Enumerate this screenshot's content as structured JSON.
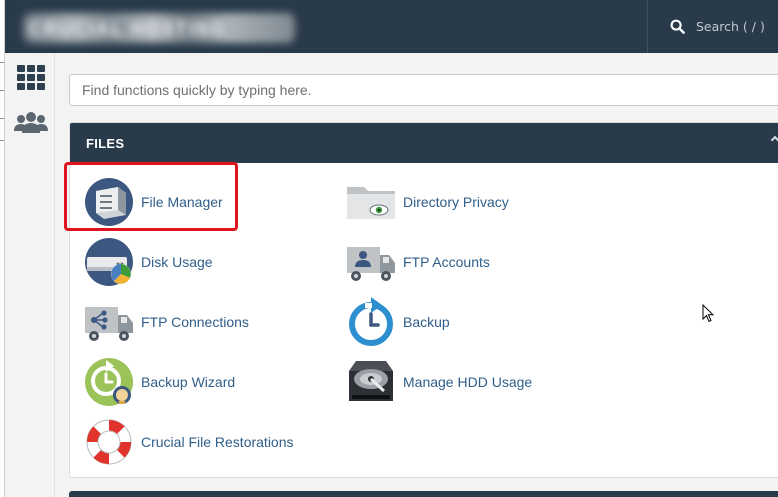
{
  "header": {
    "logo_text": "CRUCIAL HOSTING",
    "search_label": "Search ( / )"
  },
  "sidebar": {
    "items": [
      {
        "icon": "grid-icon"
      },
      {
        "icon": "users-icon"
      }
    ]
  },
  "search": {
    "placeholder": "Find functions quickly by typing here."
  },
  "files_panel": {
    "title": "FILES",
    "items": [
      {
        "label": "File Manager",
        "icon": "file-manager-icon",
        "highlighted": true
      },
      {
        "label": "Directory Privacy",
        "icon": "folder-eye-icon"
      },
      {
        "label": "Disk Usage",
        "icon": "disk-usage-icon"
      },
      {
        "label": "FTP Accounts",
        "icon": "ftp-accounts-icon"
      },
      {
        "label": "FTP Connections",
        "icon": "ftp-connections-icon"
      },
      {
        "label": "Backup",
        "icon": "backup-icon"
      },
      {
        "label": "Backup Wizard",
        "icon": "backup-wizard-icon"
      },
      {
        "label": "Manage HDD Usage",
        "icon": "hdd-icon"
      },
      {
        "label": "Crucial File Restorations",
        "icon": "lifebuoy-icon"
      }
    ]
  },
  "colors": {
    "header_bg": "#293a4a",
    "link": "#2f5e8a",
    "highlight": "#e0141e"
  }
}
